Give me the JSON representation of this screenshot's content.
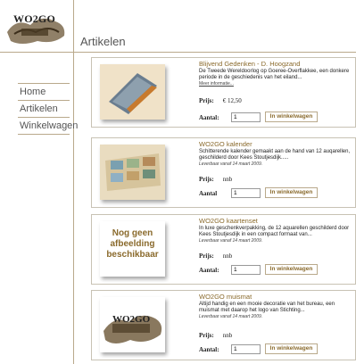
{
  "logo": {
    "text": "WO2GO",
    "suffix": "ml"
  },
  "header": {
    "title": "Artikelen"
  },
  "sidebar": {
    "items": [
      {
        "label": "Home"
      },
      {
        "label": "Artikelen"
      },
      {
        "label": "Winkelwagen"
      }
    ]
  },
  "products": [
    {
      "title": "Blijvend Gedenken - D. Hoogzand",
      "description": "De Tweede Wereldoorlog op Goeree-Overflakkee, een donkere periode in de geschiedenis van het eiland...",
      "more_link": "Meer informatie...",
      "availability": "",
      "price_label": "Prijs:",
      "price": "€ 12,50",
      "qty_label": "Aantal:",
      "qty_value": "1",
      "cart_button": "In winkelwagen"
    },
    {
      "title": "WO2GO kalender",
      "description": "Schitterende kalender gemaakt aan de hand van 12 auqarellen, geschilderd door Kees Stoutjesdijk.....",
      "more_link": "",
      "availability": "Leverbaar vanaf 14 maart 2009.",
      "price_label": "Prijs:",
      "price": "nnb",
      "qty_label": "Aantal",
      "qty_value": "1",
      "cart_button": "In winkelwagen"
    },
    {
      "title": "WO2GO kaartenset",
      "description": "In luxe geschenkverpakking, de 12 aquarellen geschilderd door Kees Stoutjesdijk in een compact formaat van...",
      "more_link": "",
      "availability": "Leverbaar vanaf 14 maart 2009.",
      "price_label": "Prijs:",
      "price": "nnb",
      "qty_label": "Aantal:",
      "qty_value": "1",
      "cart_button": "In winkelwagen",
      "placeholder_text": "Nog geen afbeelding beschikbaar"
    },
    {
      "title": "WO2GO muismat",
      "description": "Altijd handig en een mooie decoratie van het bureau, een muismat met daarop het logo van Stichting...",
      "more_link": "",
      "availability": "Leverbaar vanaf 14 maart 2009.",
      "price_label": "Prijs:",
      "price": "nnb",
      "qty_label": "Aantal:",
      "qty_value": "1",
      "cart_button": "In winkelwagen",
      "thumb_text": "WO2GO"
    }
  ]
}
